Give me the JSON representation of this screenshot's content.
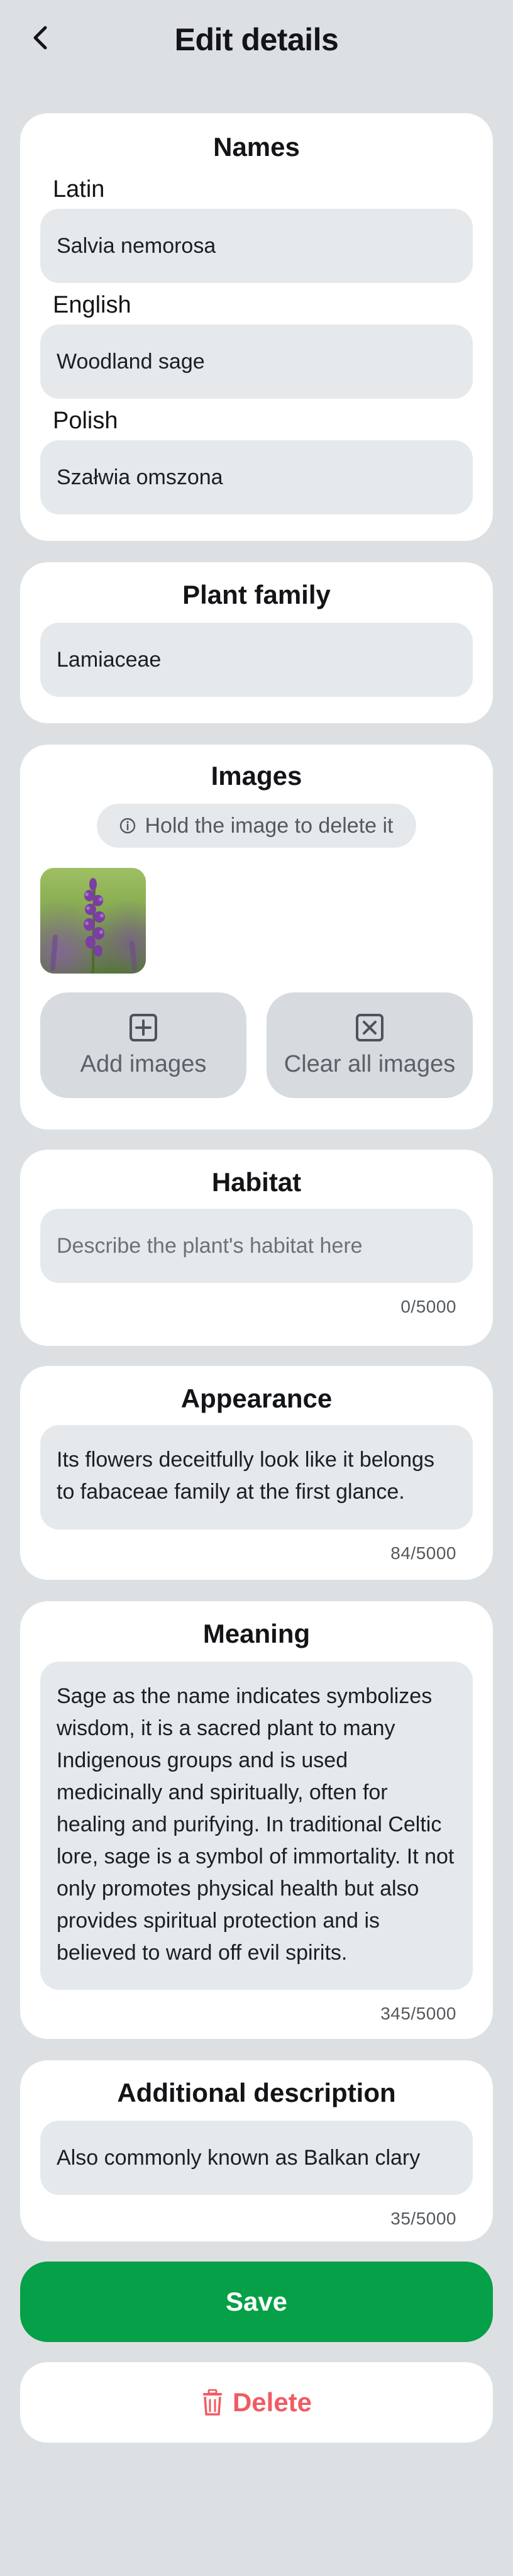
{
  "header": {
    "title": "Edit details"
  },
  "names": {
    "title": "Names",
    "latin_label": "Latin",
    "latin_value": "Salvia nemorosa",
    "english_label": "English",
    "english_value": "Woodland sage",
    "polish_label": "Polish",
    "polish_value": "Szałwia omszona"
  },
  "family": {
    "title": "Plant family",
    "value": "Lamiaceae"
  },
  "images": {
    "title": "Images",
    "hint": "Hold the image to delete it",
    "add_label": "Add images",
    "clear_label": "Clear all images"
  },
  "habitat": {
    "title": "Habitat",
    "placeholder": "Describe the plant's habitat here",
    "counter": "0/5000"
  },
  "appearance": {
    "title": "Appearance",
    "value": "Its flowers deceitfully look like it belongs to fabaceae family at the first glance.",
    "counter": "84/5000"
  },
  "meaning": {
    "title": "Meaning",
    "value": "Sage as the name indicates symbolizes wisdom, it is a sacred plant to many Indigenous groups and is used medicinally and spiritually, often for healing and purifying. In traditional Celtic lore, sage is a symbol of immortality. It not only promotes physical health but also provides spiritual protection and is believed to ward off evil spirits.",
    "counter": "345/5000"
  },
  "additional": {
    "title": "Additional description",
    "value": "Also commonly known as Balkan clary",
    "counter": "35/5000"
  },
  "actions": {
    "save_label": "Save",
    "delete_label": "Delete"
  },
  "colors": {
    "background": "#dde0e3",
    "card": "#ffffff",
    "field": "#e6e9ec",
    "save": "#05a047",
    "delete": "#f05b63"
  }
}
